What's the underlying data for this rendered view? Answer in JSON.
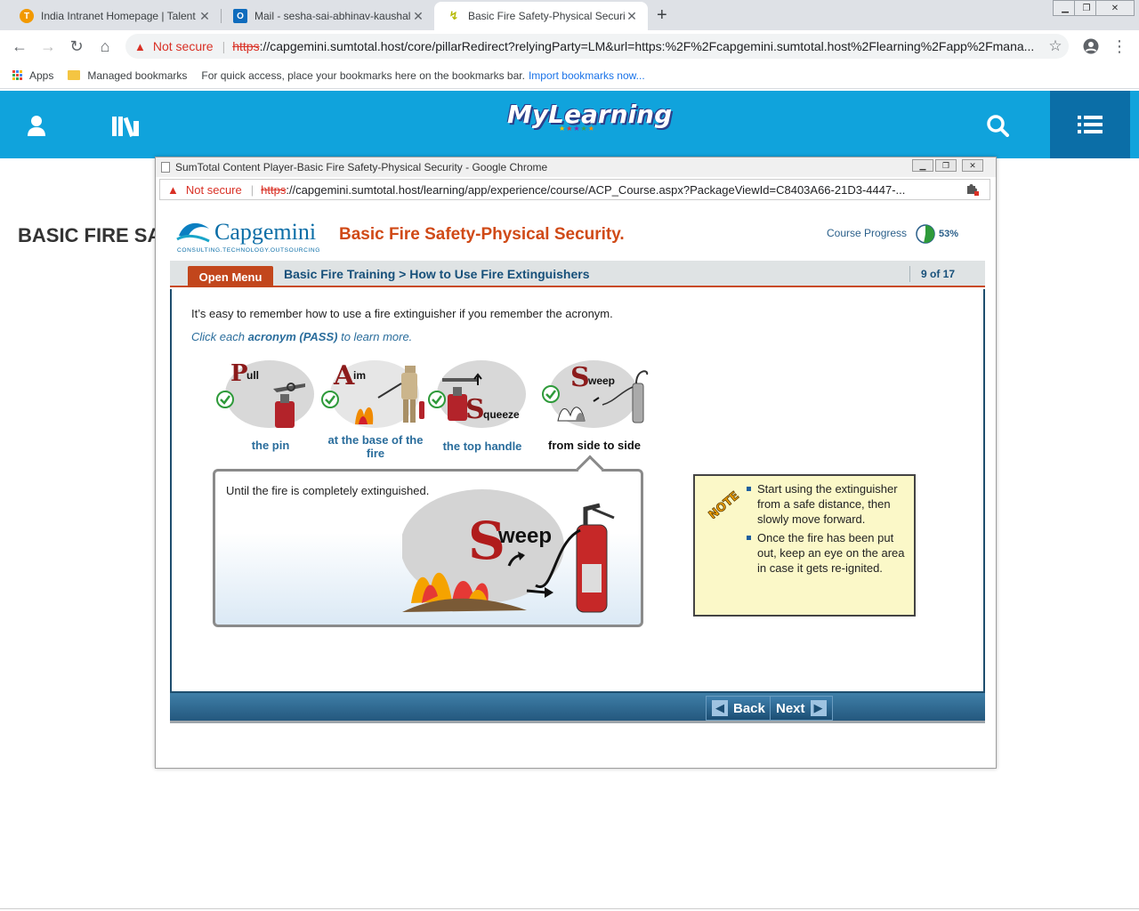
{
  "browser": {
    "tabs": [
      {
        "title": "India Intranet Homepage | Talent",
        "favicon_color": "#f29900",
        "favicon_letter": "T"
      },
      {
        "title": "Mail - sesha-sai-abhinav-kaushal",
        "favicon_color": "#0f6cbd",
        "favicon_letter": "O"
      },
      {
        "title": "Basic Fire Safety-Physical Security",
        "favicon_color": "#c8d400",
        "favicon_letter": "↯"
      }
    ],
    "close_glyph": "✕",
    "new_tab_glyph": "+",
    "security_label": "Not secure",
    "url_scheme": "https",
    "url_rest": "://capgemini.sumtotal.host/core/pillarRedirect?relyingParty=LM&url=https:%2F%2Fcapgemini.sumtotal.host%2Flearning%2Fapp%2Fmana...",
    "bookmarks": {
      "apps_label": "Apps",
      "managed_label": "Managed bookmarks",
      "hint": "For quick access, place your bookmarks here on the bookmarks bar.",
      "import_link": "Import bookmarks now..."
    }
  },
  "site": {
    "logo_text": "MyLearning",
    "page_heading": "BASIC FIRE SAI"
  },
  "popup": {
    "window_title": "SumTotal Content Player-Basic Fire Safety-Physical Security - Google Chrome",
    "security_label": "Not secure",
    "url_scheme": "https",
    "url_rest": "://capgemini.sumtotal.host/learning/app/experience/course/ACP_Course.aspx?PackageViewId=C8403A66-21D3-4447-..."
  },
  "course": {
    "brand_name": "Capgemini",
    "brand_tagline": "CONSULTING.TECHNOLOGY.OUTSOURCING",
    "title": "Basic Fire Safety-Physical Security.",
    "progress_label": "Course Progress",
    "progress_value": 53,
    "progress_text": "53%",
    "open_menu": "Open Menu",
    "breadcrumb": "Basic Fire Training > How to Use Fire Extinguishers",
    "pager": "9 of 17",
    "intro": "It’s easy to remember how to use a fire extinguisher if you remember the acronym.",
    "instruction_prefix": "Click each ",
    "instruction_bold": "acronym (PASS)",
    "instruction_suffix": " to learn more.",
    "steps": [
      {
        "letter": "P",
        "word": "ull",
        "caption": "the pin"
      },
      {
        "letter": "A",
        "word": "im",
        "caption": "at the base of the fire"
      },
      {
        "letter": "S",
        "word": "queeze",
        "caption": "the top handle"
      },
      {
        "letter": "S",
        "word": "weep",
        "caption": "from side to side"
      }
    ],
    "detail": {
      "text": "Until the fire is completely extinguished.",
      "art_letter": "S",
      "art_word": "weep"
    },
    "note": {
      "tag": "NOTE",
      "items": [
        "Start using the extinguisher from a safe distance, then slowly move forward.",
        "Once the fire has been put out, keep an eye on the area in case it gets re-ignited."
      ]
    },
    "nav": {
      "back": "Back",
      "next": "Next"
    }
  },
  "colors": {
    "header_blue": "#10a3dc",
    "menu_blue": "#0b6ea7",
    "course_title": "#d04a17",
    "accent_red": "#c2461c",
    "link_blue": "#2a6d9c"
  }
}
